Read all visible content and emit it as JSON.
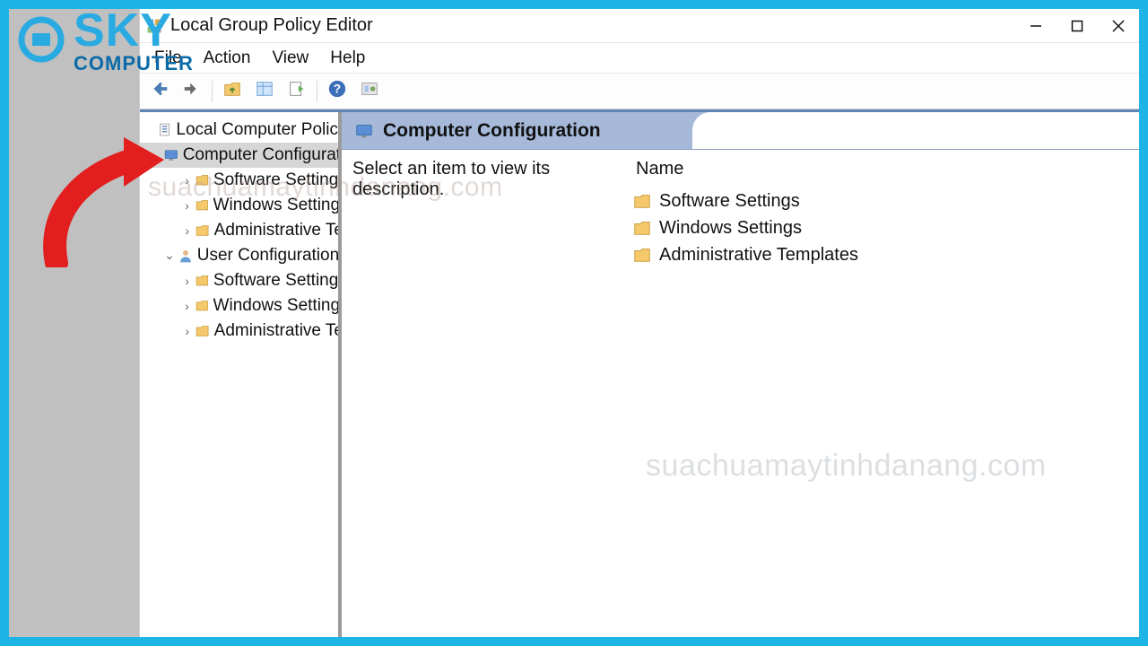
{
  "window": {
    "title": "Local Group Policy Editor"
  },
  "menu": {
    "file": "File",
    "action": "Action",
    "view": "View",
    "help": "Help"
  },
  "tree": {
    "root": "Local Computer Policy",
    "computer_config": "Computer Configurat",
    "cc_software": "Software Settings",
    "cc_windows": "Windows Settings",
    "cc_admin": "Administrative Te",
    "user_config": "User Configuration",
    "uc_software": "Software Settings",
    "uc_windows": "Windows Settings",
    "uc_admin": "Administrative Te"
  },
  "content": {
    "header_title": "Computer Configuration",
    "description_prompt": "Select an item to view its description.",
    "col_name": "Name",
    "items": {
      "software": "Software Settings",
      "windows": "Windows Settings",
      "admin": "Administrative Templates"
    }
  },
  "logo": {
    "line1": "SKY",
    "line2": "COMPUTER"
  },
  "watermark": "suachuamaytinhdanang.com"
}
